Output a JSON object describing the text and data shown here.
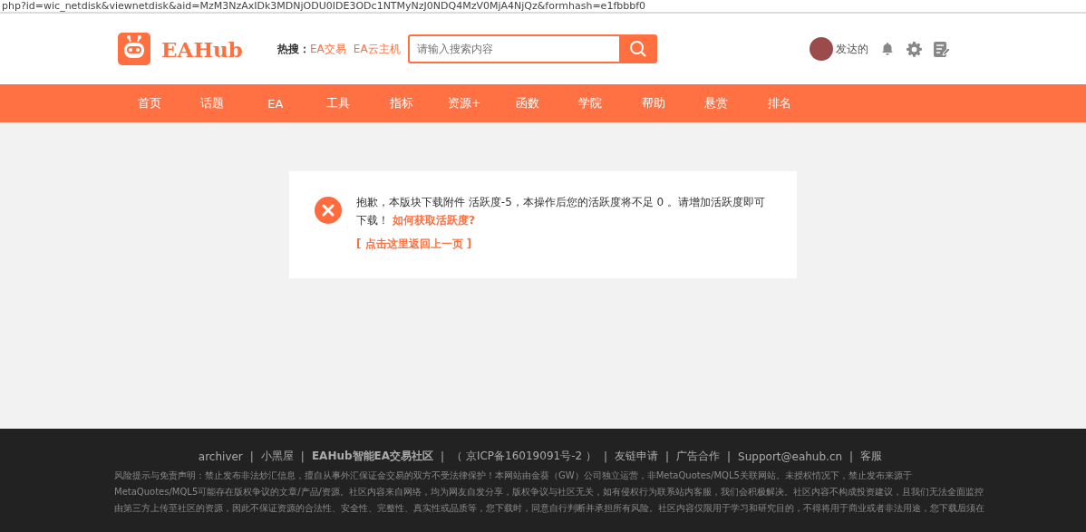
{
  "address_bar": {
    "url": "php?id=wic_netdisk&viewnetdisk&aid=MzM3NzAxIDk3MDNjODU0IDE3ODc1NTMyNzJ0NDQ4MzV0MjA4NjQz&formhash=e1fbbbf0"
  },
  "header": {
    "logo_text": "EAHub",
    "hot_label": "热搜：",
    "hot_links": [
      "EA交易",
      "EA云主机"
    ],
    "search": {
      "placeholder": "请输入搜索内容"
    },
    "username": "发达的"
  },
  "nav": [
    {
      "label": "首页"
    },
    {
      "label": "话题"
    },
    {
      "label": "EA"
    },
    {
      "label": "工具"
    },
    {
      "label": "指标"
    },
    {
      "label": "资源+"
    },
    {
      "label": "函数"
    },
    {
      "label": "学院"
    },
    {
      "label": "帮助"
    },
    {
      "label": "悬赏"
    },
    {
      "label": "排名"
    }
  ],
  "message": {
    "text": "抱歉，本版块下载附件 活跃度-5，本操作后您的活跃度将不足 0 。请增加活跃度即可下载！",
    "help_link": "如何获取活跃度?",
    "back_link": "[ 点击这里返回上一页 ]"
  },
  "footer": {
    "separator": "|",
    "links": [
      {
        "kind": "link",
        "text": "archiver"
      },
      {
        "kind": "link",
        "text": "小黑屋"
      },
      {
        "kind": "strong",
        "text": "EAHub智能EA交易社区"
      },
      {
        "kind": "link",
        "text": "（ 京ICP备16019091号-2 ）"
      },
      {
        "kind": "link",
        "text": "友链申请"
      },
      {
        "kind": "link",
        "text": "广告合作"
      },
      {
        "kind": "link",
        "text": "Support@eahub.cn"
      },
      {
        "kind": "link",
        "text": "客服"
      }
    ],
    "disclaimer": [
      "风险提示与免责声明：禁止发布非法炒汇信息，擅自从事外汇保证金交易的双方不受法律保护！本网站由金葵（GW）公司独立运营，非MetaQuotes/MQL5关联网站。未授权情况下，禁止发布来源于",
      "MetaQuotes/MQL5可能存在版权争议的文章/产品/资源。社区内容来自网络，均为网友自发分享，版权争议与社区无关，如有侵权行为联系站内客服，我们会积极解决。社区内容不构成投资建议，且我们无法全面监控",
      "由第三方上传至社区的资源，因此不保证资源的合法性、安全性、完整性、真实性或品质等，您下载时，同意自行判断并承担所有风险。社区内容仅限用于学习和研究目的，不得将用于商业或者非法用途，您下载后须在"
    ]
  }
}
